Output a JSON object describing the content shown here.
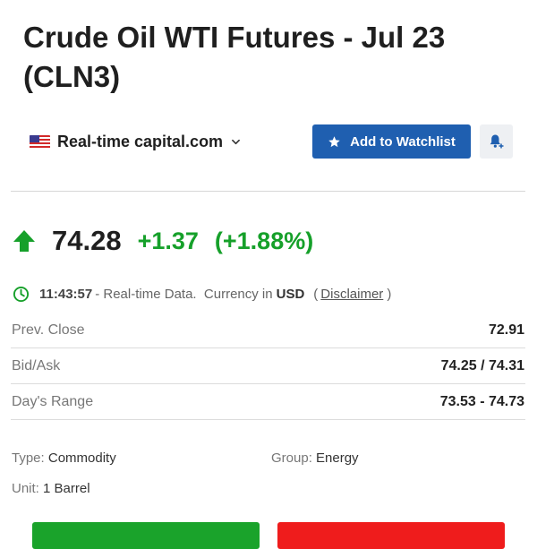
{
  "header": {
    "title": "Crude Oil WTI Futures - Jul 23 (CLN3)"
  },
  "source": {
    "label": "Real-time capital.com",
    "flag_icon": "us-flag-icon",
    "dropdown_icon": "chevron-down-icon"
  },
  "actions": {
    "watchlist_label": "Add to Watchlist",
    "watchlist_icon": "star-icon",
    "alert_icon": "bell-plus-icon"
  },
  "quote": {
    "price": "74.28",
    "change": "+1.37",
    "change_percent": "(+1.88%)",
    "direction_icon": "arrow-up-icon",
    "up_color": "#16a02a"
  },
  "status": {
    "time": "11:43:57",
    "text": "- Real-time Data.  Currency in",
    "currency": "USD",
    "open_paren": "(",
    "disclaimer": "Disclaimer",
    "close_paren": ")",
    "clock_icon": "clock-icon"
  },
  "stats": [
    {
      "label": "Prev. Close",
      "value": "72.91"
    },
    {
      "label": "Bid/Ask",
      "value": "74.25 / 74.31"
    },
    {
      "label": "Day's Range",
      "value": "73.53 - 74.73"
    }
  ],
  "details": {
    "type_label": "Type:",
    "type_value": "Commodity",
    "group_label": "Group:",
    "group_value": "Energy",
    "unit_label": "Unit:",
    "unit_value": "1 Barrel"
  },
  "colors": {
    "brand_blue": "#1f5fb0",
    "buy_green": "#1aa32b",
    "sell_red": "#ef1c1c"
  }
}
